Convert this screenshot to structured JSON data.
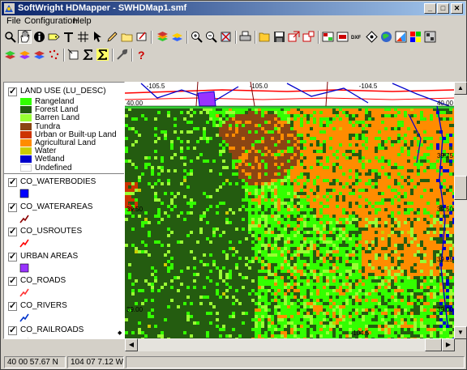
{
  "window": {
    "title": "SoftWright HDMapper - SWHDMap1.smf"
  },
  "menu": {
    "file": "File",
    "configuration": "Configuration",
    "help": "Help"
  },
  "legend": {
    "land_use_title": "LAND USE (LU_DESC)",
    "land_use_classes": [
      {
        "label": "Rangeland",
        "color": "#33ff00"
      },
      {
        "label": "Forest Land",
        "color": "#245c10"
      },
      {
        "label": "Barren Land",
        "color": "#99ff33"
      },
      {
        "label": "Tundra",
        "color": "#8b4513"
      },
      {
        "label": "Urban or Built-up Land",
        "color": "#cc3300"
      },
      {
        "label": "Agricultural Land",
        "color": "#ff8c00"
      },
      {
        "label": "Water",
        "color": "#cccc00"
      },
      {
        "label": "Wetland",
        "color": "#0000cc"
      },
      {
        "label": "Undefined",
        "color": "#ffffff"
      }
    ],
    "layers": [
      {
        "name": "CO_WATERBODIES",
        "symbol": "fill",
        "color": "#0000ff"
      },
      {
        "name": "CO_WATERAREAS",
        "symbol": "line",
        "color": "#8b0000"
      },
      {
        "name": "CO_USROUTES",
        "symbol": "line",
        "color": "#ff0000"
      },
      {
        "name": "URBAN AREAS",
        "symbol": "fill",
        "color": "#9933ff"
      },
      {
        "name": "CO_ROADS",
        "symbol": "line",
        "color": "#ff3333"
      },
      {
        "name": "CO_RIVERS",
        "symbol": "line",
        "color": "#0033cc"
      },
      {
        "name": "CO_RAILROADS",
        "symbol": "line",
        "color": "#333300"
      }
    ]
  },
  "map": {
    "top_labels": [
      "-105.5",
      "-105.0",
      "-104.5"
    ],
    "left_labels": [
      "40.00",
      "39.50",
      "39.00"
    ],
    "right_labels": [
      "40.00",
      "39.75",
      "39.50",
      "39.25",
      "39.00"
    ],
    "bottom_label": "-104.5"
  },
  "status": {
    "latitude": "40 00 57.67 N",
    "longitude": "104 07 7.12 W"
  }
}
